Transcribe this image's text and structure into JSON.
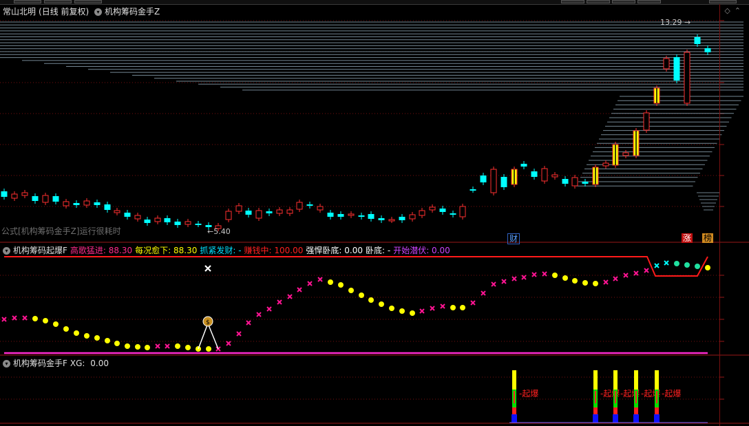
{
  "main_panel": {
    "stock_name": "常山北明",
    "period": "(日线 前复权)",
    "indicator_name": "机构筹码金手Z",
    "max_label": "13.29",
    "min_label": "5.40",
    "note": "公式[机构筹码金手Z]运行很耗时",
    "badges": {
      "cai": "财",
      "zhang": "涨",
      "bang": "榜"
    }
  },
  "panel2": {
    "name": "机构筹码起爆F",
    "fields": [
      {
        "label": "高歌猛进:",
        "value": "88.30",
        "color": "#ff2a8c"
      },
      {
        "label": "每况愈下:",
        "value": "88.30",
        "color": "#ffff00"
      },
      {
        "label": "抓紧发财:",
        "value": "-",
        "color": "#00e0ff"
      },
      {
        "label": "赚钱中:",
        "value": "100.00",
        "color": "#ff2020"
      },
      {
        "label": "强悍卧底:",
        "value": "0.00",
        "color": "#ffffff"
      },
      {
        "label": "卧底:",
        "value": "-",
        "color": "#ffffff"
      },
      {
        "label": "开始潜伏:",
        "value": "0.00",
        "color": "#cc44ff"
      }
    ],
    "money_icon": "money-bag-icon"
  },
  "panel3": {
    "name": "机构筹码金手F",
    "xg_label": "XG:",
    "xg_value": "0.00",
    "signal_label": "起爆",
    "signal_count": 5
  },
  "colors": {
    "up": "#ff3030",
    "down": "#00ffff",
    "gold": "#ffff00",
    "magenta": "#ff1493",
    "grid": "#7a1010"
  }
}
